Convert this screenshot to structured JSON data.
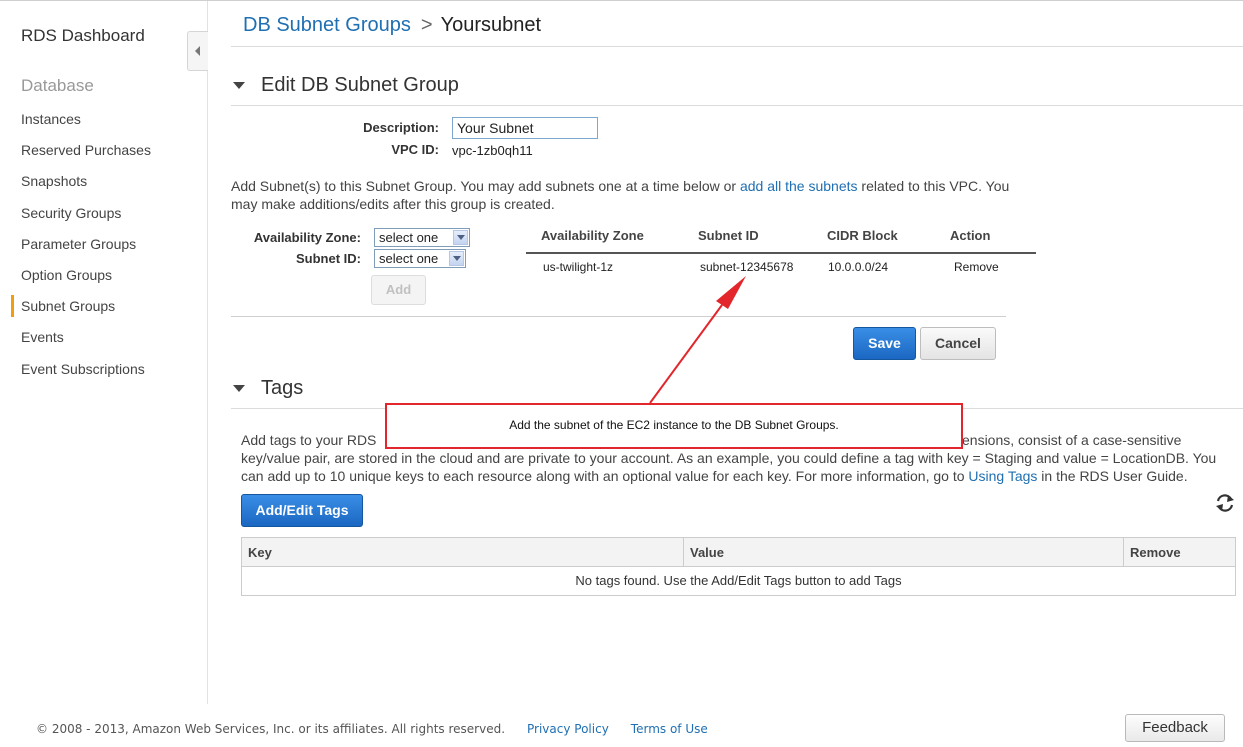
{
  "sidebar": {
    "title": "RDS Dashboard",
    "section": "Database",
    "items": [
      {
        "label": "Instances"
      },
      {
        "label": "Reserved Purchases"
      },
      {
        "label": "Snapshots"
      },
      {
        "label": "Security Groups"
      },
      {
        "label": "Parameter Groups"
      },
      {
        "label": "Option Groups"
      },
      {
        "label": "Subnet Groups",
        "active": true
      },
      {
        "label": "Events"
      },
      {
        "label": "Event Subscriptions"
      }
    ]
  },
  "breadcrumb": {
    "parent": "DB Subnet Groups",
    "separator": ">",
    "current": "Yoursubnet"
  },
  "edit_section": {
    "title": "Edit DB Subnet Group",
    "description_label": "Description:",
    "description_value": "Your Subnet",
    "vpc_label": "VPC ID:",
    "vpc_value": "vpc-1zb0qh11",
    "info_before": "Add Subnet(s) to this Subnet Group. You may add subnets one at a time below or ",
    "info_link": "add all the subnets",
    "info_after_line1": " related to this VPC. You",
    "info_line2": "may make additions/edits after this group is created.",
    "az_label": "Availability Zone:",
    "az_select": "select one",
    "subnet_label": "Subnet ID:",
    "subnet_select": "select one",
    "add_button": "Add",
    "table": {
      "headers": [
        "Availability Zone",
        "Subnet ID",
        "CIDR Block",
        "Action"
      ],
      "rows": [
        {
          "az": "us-twilight-1z",
          "subnet_id": "subnet-12345678",
          "cidr": "10.0.0.0/24",
          "action": "Remove"
        }
      ]
    },
    "save_button": "Save",
    "cancel_button": "Cancel"
  },
  "callout": {
    "text": "Add the subnet of the EC2 instance to the DB Subnet Groups.",
    "color": "#e2262b"
  },
  "tags_section": {
    "title": "Tags",
    "para_line1": "Add tags to your RDS r",
    "para_line1_end": "ensions, consist of a case-sensitive",
    "para_line2": "key/value pair, are stored in the cloud and are private to your account. As an example, you could define a tag with key = Staging and value = LocationDB. You",
    "para_line3_before": "can add up to 10 unique keys to each resource along with an optional value for each key. For more information, go to ",
    "para_link": "Using Tags",
    "para_line3_after": " in the RDS User Guide.",
    "add_edit_button": "Add/Edit Tags",
    "refresh_icon": "refresh-icon",
    "table": {
      "headers": [
        "Key",
        "Value",
        "Remove"
      ],
      "empty": "No tags found. Use the Add/Edit Tags button to add Tags"
    }
  },
  "footer": {
    "copyright": "© 2008 - 2013, Amazon Web Services, Inc. or its affiliates. All rights reserved.",
    "privacy": "Privacy Policy",
    "terms": "Terms of Use",
    "feedback": "Feedback"
  },
  "colors": {
    "link": "#1f6fb2",
    "primary_button": "#1a67c2",
    "active_marker": "#f39c12"
  }
}
